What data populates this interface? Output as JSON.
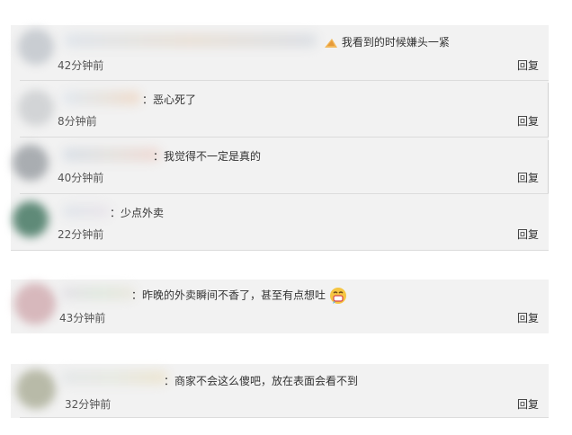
{
  "panel1": {
    "comments": [
      {
        "text": "我看到的时候嫌头一紧",
        "time": "42分钟前",
        "reply": "回复"
      },
      {
        "text": "：恶心死了",
        "time": "8分钟前",
        "reply": "回复"
      },
      {
        "text": "：我觉得不一定是真的",
        "time": "40分钟前",
        "reply": "回复"
      },
      {
        "text": "：少点外卖",
        "time": "22分钟前",
        "reply": "回复"
      }
    ]
  },
  "panel2": {
    "text": "：昨晚的外卖瞬间不香了，甚至有点想吐",
    "time": "43分钟前",
    "reply": "回复"
  },
  "panel3": {
    "text": "：商家不会这么傻吧，放在表面会看不到",
    "time": "32分钟前",
    "reply": "回复"
  },
  "colors": {
    "panel_bg": "#f2f2f2",
    "separator": "#dcdcdc"
  },
  "icons": [
    "sweat-emoji-icon",
    "nauseated-emoji-icon"
  ]
}
